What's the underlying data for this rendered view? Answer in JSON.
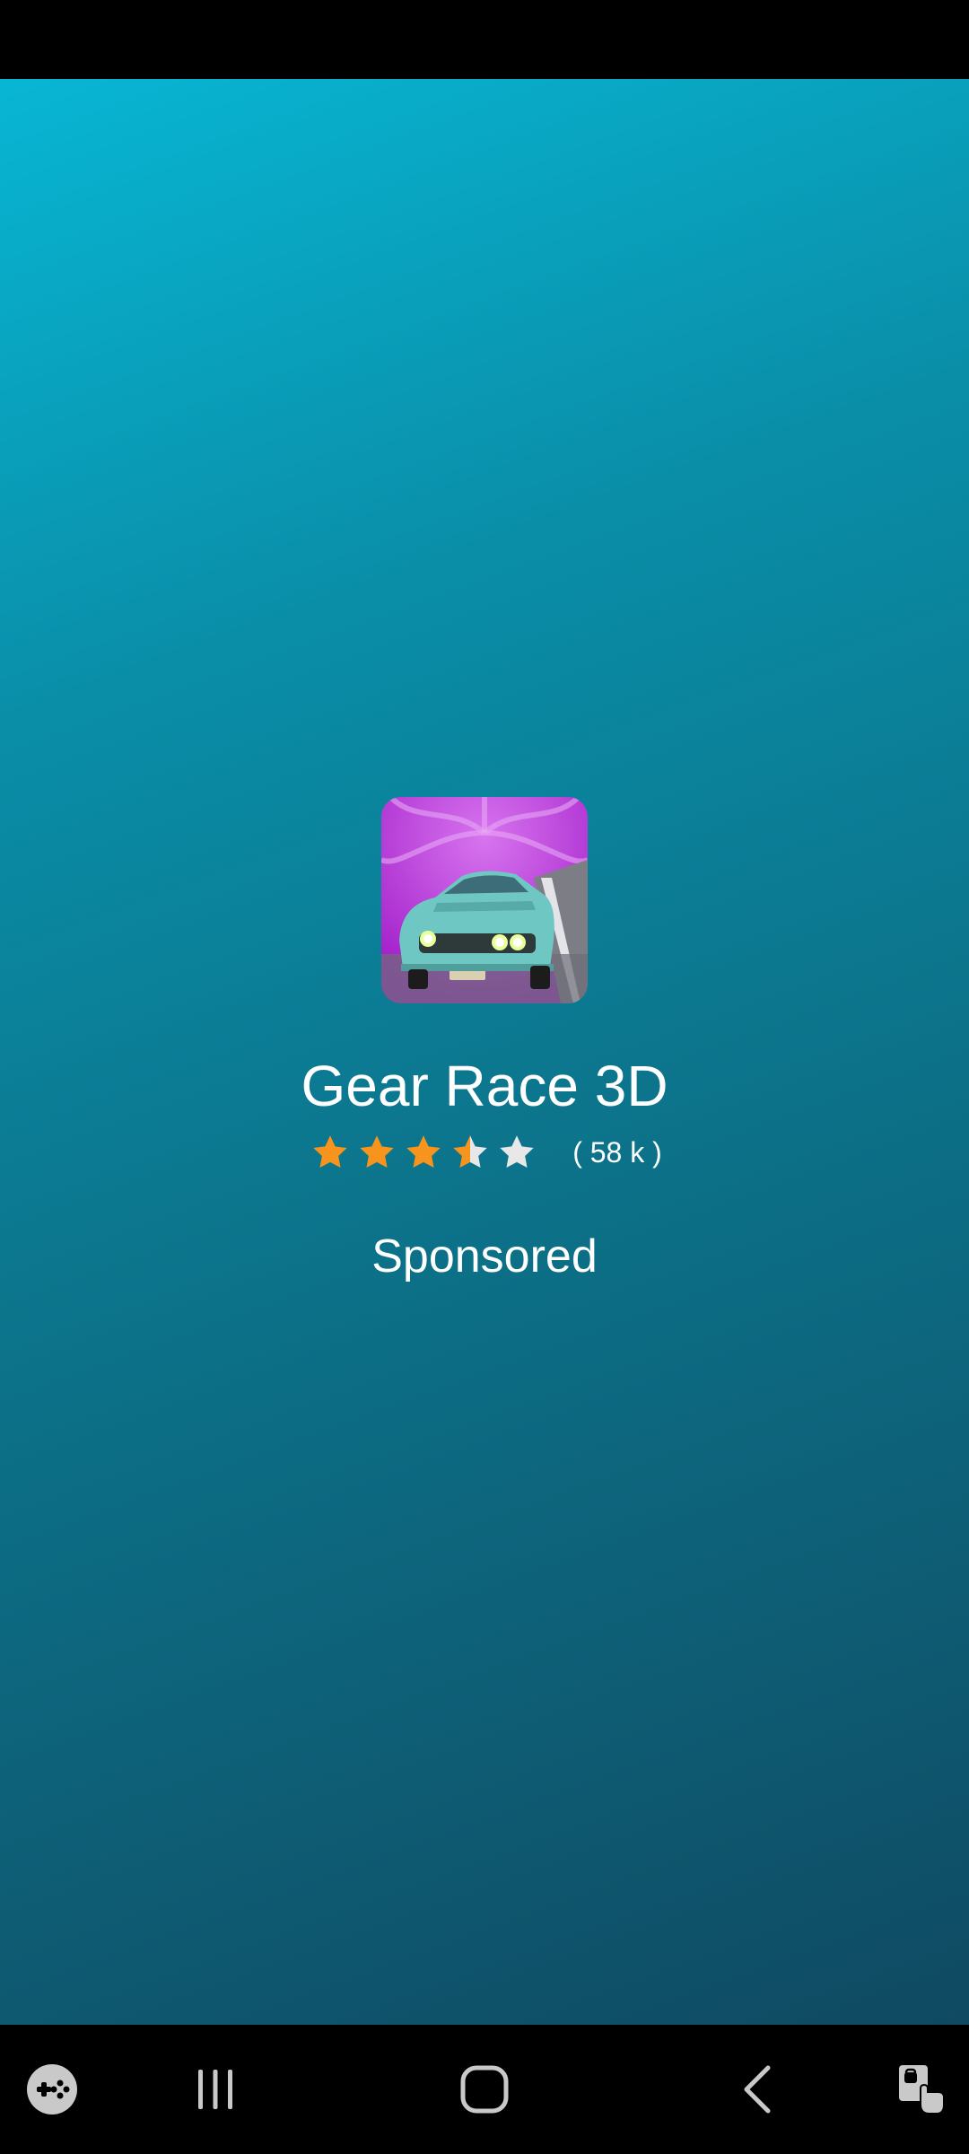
{
  "ad": {
    "app_name": "Gear Race 3D",
    "rating": 3.5,
    "rating_max": 5,
    "rating_count": "( 58 k )",
    "sponsored_label": "Sponsored",
    "icon": "race-car-app-icon"
  },
  "colors": {
    "star_filled": "#f7941d",
    "star_empty": "#e8e8e8",
    "background_top": "#08b6d4",
    "background_bottom": "#0f4a62"
  },
  "nav_bar": {
    "items": [
      "game-launcher-icon",
      "recent-apps-icon",
      "home-icon",
      "back-icon",
      "screen-touch-icon"
    ]
  }
}
